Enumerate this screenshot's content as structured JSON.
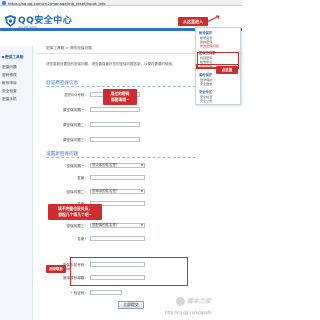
{
  "browser": {
    "url": "https://aq.qq.com/cn2/manage/mb_reset/input_info"
  },
  "header": {
    "logo_title": "QQ安全中心",
    "logo_sub": "aq.qq.com"
  },
  "sidebar": {
    "items": [
      {
        "label": "密保工具箱",
        "active": true
      },
      {
        "label": "密保问题"
      },
      {
        "label": "密码修改"
      },
      {
        "label": "帐号申诉"
      },
      {
        "label": "安全检查"
      },
      {
        "label": "密保手机"
      }
    ]
  },
  "breadcrumb": "密保工具箱 > 修改密保问题",
  "intro_text": "请您重新设置您的密保问题，请妥善保管好您的密保问题答案，以便在需要时使用。",
  "sections": {
    "verify_title": "验证原密保信息",
    "reset_title": "设置新密保问题"
  },
  "verify_fields": [
    {
      "label": "您的QQ号码："
    },
    {
      "label": "原密保问题一："
    },
    {
      "label": "原密保问题二："
    },
    {
      "label": "原密保问题三："
    }
  ],
  "questions": [
    {
      "label": "密保问题一：",
      "select": "您父亲的姓名是？",
      "answer_label": "答案："
    },
    {
      "label": "密保问题二：",
      "select": "您母亲的姓名是？",
      "answer_label": "答案："
    },
    {
      "label": "密保问题三：",
      "select": "您配偶的姓名是？",
      "answer_label": "答案："
    }
  ],
  "extra_fields": [
    {
      "label": "密保手机号码："
    },
    {
      "label": "常用联系邮箱："
    },
    {
      "label": "* 验证码："
    }
  ],
  "submit_label": "立即提交",
  "annotations": {
    "top_right": "从这里进入",
    "menu_pointer": "点这里",
    "memory_hint": "用过的密码\n都要填哦~",
    "question_hint": "填不完整也没关系，\n想起几个填几个吧~",
    "fields_hint": "用来联系"
  },
  "dropdown": {
    "groups": [
      {
        "title": "帐号保护",
        "items": [
          "帐号设置",
          "我的密保",
          "修改密保问题"
        ]
      },
      {
        "title": "密保工具箱",
        "items": [
          "找回密码",
          "帐号申诉",
          "修改密码"
        ]
      },
      {
        "title": "实时保护",
        "items": [
          "登录保护",
          "安全登录"
        ]
      },
      {
        "title": "安全专区",
        "items": [
          "安全检查",
          "安全公告"
        ]
      }
    ],
    "highlight": "修改密保问题"
  },
  "watermark": {
    "brand": "脚本之家",
    "url": "http://cq.qq.com/jqsafe"
  },
  "colors": {
    "brand_blue": "#2f73c4",
    "annotation_red": "#cf2d2d"
  }
}
